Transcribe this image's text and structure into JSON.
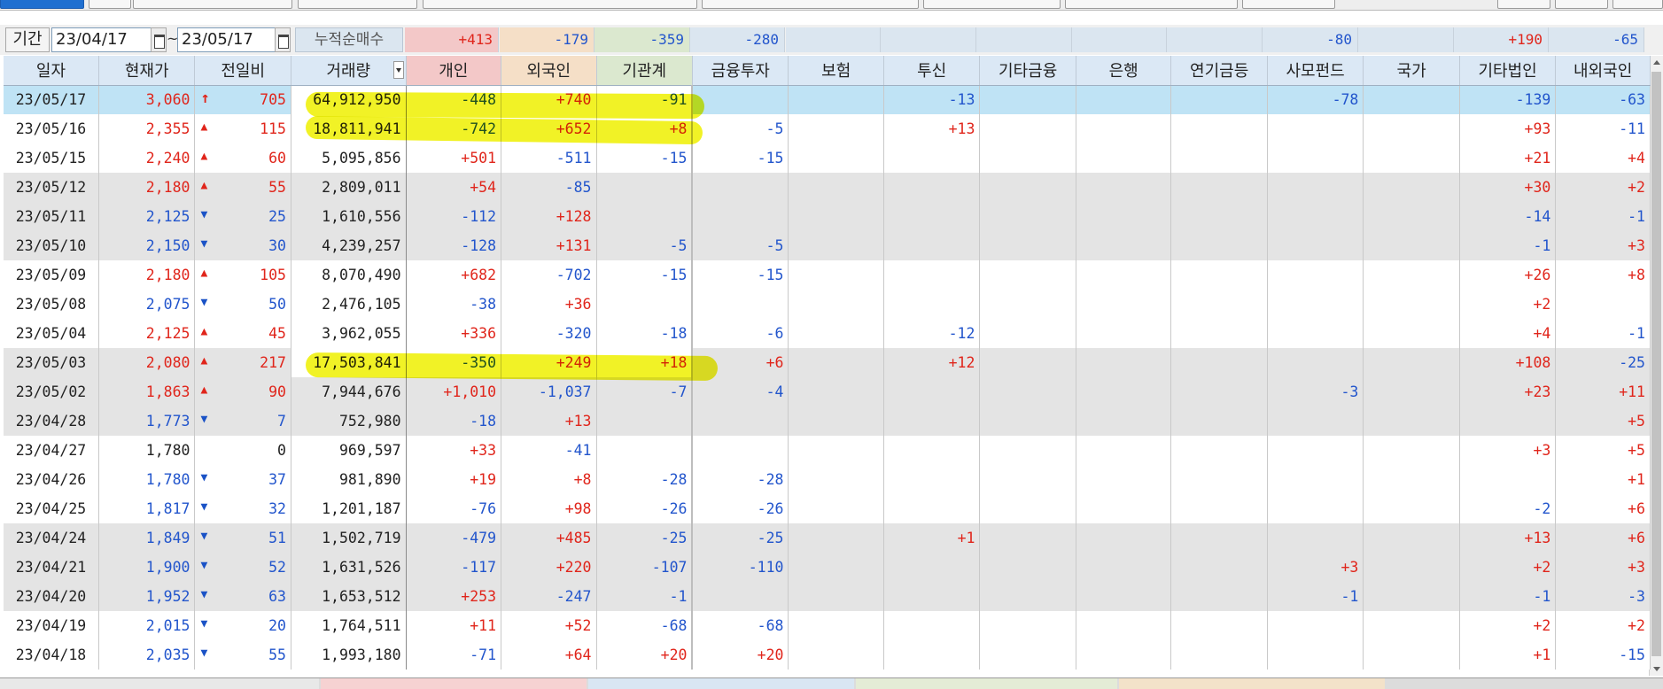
{
  "period": {
    "label": "기간",
    "start": "23/04/17",
    "tilde": "~",
    "end": "23/05/17",
    "cum_label": "누적순매수",
    "sums": [
      "+413",
      "-179",
      "-359",
      "-280",
      "",
      "",
      "",
      "",
      "",
      "-80",
      "",
      "+190",
      "-65"
    ]
  },
  "columns": [
    "일자",
    "현재가",
    "전일비",
    "거래량",
    "개인",
    "외국인",
    "기관계",
    "금융투자",
    "보험",
    "투신",
    "기타금융",
    "은행",
    "연기금등",
    "사모펀드",
    "국가",
    "기타법인",
    "내외국인"
  ],
  "rows": [
    {
      "date": "23/05/17",
      "price": "3,060",
      "dir": "limit",
      "chg": "705",
      "vol": "64,912,950",
      "ind": "-448",
      "for": "+740",
      "ins": "-91",
      "fin": "",
      "insu": "",
      "inv": "-13",
      "etcfin": "",
      "bank": "",
      "pen": "",
      "pe": "-78",
      "gov": "",
      "corp": "-139",
      "dom": "-63"
    },
    {
      "date": "23/05/16",
      "price": "2,355",
      "dir": "up",
      "chg": "115",
      "vol": "18,811,941",
      "ind": "-742",
      "for": "+652",
      "ins": "+8",
      "fin": "-5",
      "insu": "",
      "inv": "+13",
      "etcfin": "",
      "bank": "",
      "pen": "",
      "pe": "",
      "gov": "",
      "corp": "+93",
      "dom": "-11"
    },
    {
      "date": "23/05/15",
      "price": "2,240",
      "dir": "up",
      "chg": "60",
      "vol": "5,095,856",
      "ind": "+501",
      "for": "-511",
      "ins": "-15",
      "fin": "-15",
      "insu": "",
      "inv": "",
      "etcfin": "",
      "bank": "",
      "pen": "",
      "pe": "",
      "gov": "",
      "corp": "+21",
      "dom": "+4"
    },
    {
      "date": "23/05/12",
      "price": "2,180",
      "dir": "up",
      "chg": "55",
      "vol": "2,809,011",
      "ind": "+54",
      "for": "-85",
      "ins": "",
      "fin": "",
      "insu": "",
      "inv": "",
      "etcfin": "",
      "bank": "",
      "pen": "",
      "pe": "",
      "gov": "",
      "corp": "+30",
      "dom": "+2"
    },
    {
      "date": "23/05/11",
      "price": "2,125",
      "dir": "down",
      "chg": "25",
      "vol": "1,610,556",
      "ind": "-112",
      "for": "+128",
      "ins": "",
      "fin": "",
      "insu": "",
      "inv": "",
      "etcfin": "",
      "bank": "",
      "pen": "",
      "pe": "",
      "gov": "",
      "corp": "-14",
      "dom": "-1"
    },
    {
      "date": "23/05/10",
      "price": "2,150",
      "dir": "down",
      "chg": "30",
      "vol": "4,239,257",
      "ind": "-128",
      "for": "+131",
      "ins": "-5",
      "fin": "-5",
      "insu": "",
      "inv": "",
      "etcfin": "",
      "bank": "",
      "pen": "",
      "pe": "",
      "gov": "",
      "corp": "-1",
      "dom": "+3"
    },
    {
      "date": "23/05/09",
      "price": "2,180",
      "dir": "up",
      "chg": "105",
      "vol": "8,070,490",
      "ind": "+682",
      "for": "-702",
      "ins": "-15",
      "fin": "-15",
      "insu": "",
      "inv": "",
      "etcfin": "",
      "bank": "",
      "pen": "",
      "pe": "",
      "gov": "",
      "corp": "+26",
      "dom": "+8"
    },
    {
      "date": "23/05/08",
      "price": "2,075",
      "dir": "down",
      "chg": "50",
      "vol": "2,476,105",
      "ind": "-38",
      "for": "+36",
      "ins": "",
      "fin": "",
      "insu": "",
      "inv": "",
      "etcfin": "",
      "bank": "",
      "pen": "",
      "pe": "",
      "gov": "",
      "corp": "+2",
      "dom": ""
    },
    {
      "date": "23/05/04",
      "price": "2,125",
      "dir": "up",
      "chg": "45",
      "vol": "3,962,055",
      "ind": "+336",
      "for": "-320",
      "ins": "-18",
      "fin": "-6",
      "insu": "",
      "inv": "-12",
      "etcfin": "",
      "bank": "",
      "pen": "",
      "pe": "",
      "gov": "",
      "corp": "+4",
      "dom": "-1"
    },
    {
      "date": "23/05/03",
      "price": "2,080",
      "dir": "up",
      "chg": "217",
      "vol": "17,503,841",
      "ind": "-350",
      "for": "+249",
      "ins": "+18",
      "fin": "+6",
      "insu": "",
      "inv": "+12",
      "etcfin": "",
      "bank": "",
      "pen": "",
      "pe": "",
      "gov": "",
      "corp": "+108",
      "dom": "-25"
    },
    {
      "date": "23/05/02",
      "price": "1,863",
      "dir": "up",
      "chg": "90",
      "vol": "7,944,676",
      "ind": "+1,010",
      "for": "-1,037",
      "ins": "-7",
      "fin": "-4",
      "insu": "",
      "inv": "",
      "etcfin": "",
      "bank": "",
      "pen": "",
      "pe": "-3",
      "gov": "",
      "corp": "+23",
      "dom": "+11"
    },
    {
      "date": "23/04/28",
      "price": "1,773",
      "dir": "down",
      "chg": "7",
      "vol": "752,980",
      "ind": "-18",
      "for": "+13",
      "ins": "",
      "fin": "",
      "insu": "",
      "inv": "",
      "etcfin": "",
      "bank": "",
      "pen": "",
      "pe": "",
      "gov": "",
      "corp": "",
      "dom": "+5"
    },
    {
      "date": "23/04/27",
      "price": "1,780",
      "dir": "flat",
      "chg": "0",
      "vol": "969,597",
      "ind": "+33",
      "for": "-41",
      "ins": "",
      "fin": "",
      "insu": "",
      "inv": "",
      "etcfin": "",
      "bank": "",
      "pen": "",
      "pe": "",
      "gov": "",
      "corp": "+3",
      "dom": "+5"
    },
    {
      "date": "23/04/26",
      "price": "1,780",
      "dir": "down",
      "chg": "37",
      "vol": "981,890",
      "ind": "+19",
      "for": "+8",
      "ins": "-28",
      "fin": "-28",
      "insu": "",
      "inv": "",
      "etcfin": "",
      "bank": "",
      "pen": "",
      "pe": "",
      "gov": "",
      "corp": "",
      "dom": "+1"
    },
    {
      "date": "23/04/25",
      "price": "1,817",
      "dir": "down",
      "chg": "32",
      "vol": "1,201,187",
      "ind": "-76",
      "for": "+98",
      "ins": "-26",
      "fin": "-26",
      "insu": "",
      "inv": "",
      "etcfin": "",
      "bank": "",
      "pen": "",
      "pe": "",
      "gov": "",
      "corp": "-2",
      "dom": "+6"
    },
    {
      "date": "23/04/24",
      "price": "1,849",
      "dir": "down",
      "chg": "51",
      "vol": "1,502,719",
      "ind": "-479",
      "for": "+485",
      "ins": "-25",
      "fin": "-25",
      "insu": "",
      "inv": "+1",
      "etcfin": "",
      "bank": "",
      "pen": "",
      "pe": "",
      "gov": "",
      "corp": "+13",
      "dom": "+6"
    },
    {
      "date": "23/04/21",
      "price": "1,900",
      "dir": "down",
      "chg": "52",
      "vol": "1,631,526",
      "ind": "-117",
      "for": "+220",
      "ins": "-107",
      "fin": "-110",
      "insu": "",
      "inv": "",
      "etcfin": "",
      "bank": "",
      "pen": "",
      "pe": "+3",
      "gov": "",
      "corp": "+2",
      "dom": "+3"
    },
    {
      "date": "23/04/20",
      "price": "1,952",
      "dir": "down",
      "chg": "63",
      "vol": "1,653,512",
      "ind": "+253",
      "for": "-247",
      "ins": "-1",
      "fin": "",
      "insu": "",
      "inv": "",
      "etcfin": "",
      "bank": "",
      "pen": "",
      "pe": "-1",
      "gov": "",
      "corp": "-1",
      "dom": "-3"
    },
    {
      "date": "23/04/19",
      "price": "2,015",
      "dir": "down",
      "chg": "20",
      "vol": "1,764,511",
      "ind": "+11",
      "for": "+52",
      "ins": "-68",
      "fin": "-68",
      "insu": "",
      "inv": "",
      "etcfin": "",
      "bank": "",
      "pen": "",
      "pe": "",
      "gov": "",
      "corp": "+2",
      "dom": "+2"
    },
    {
      "date": "23/04/18",
      "price": "2,035",
      "dir": "down",
      "chg": "55",
      "vol": "1,993,180",
      "ind": "-71",
      "for": "+64",
      "ins": "+20",
      "fin": "+20",
      "insu": "",
      "inv": "",
      "etcfin": "",
      "bank": "",
      "pen": "",
      "pe": "",
      "gov": "",
      "corp": "+1",
      "dom": "-15"
    }
  ],
  "row_bands": [
    "sel",
    "w",
    "w",
    "g",
    "g",
    "g",
    "w",
    "w",
    "w",
    "g",
    "g",
    "g",
    "w",
    "w",
    "w",
    "g",
    "g",
    "g",
    "w",
    "w"
  ],
  "colors": {
    "up": "#e0251b",
    "down": "#2255cc",
    "selected_row": "#bfe3f5",
    "highlight": "#eef000"
  }
}
